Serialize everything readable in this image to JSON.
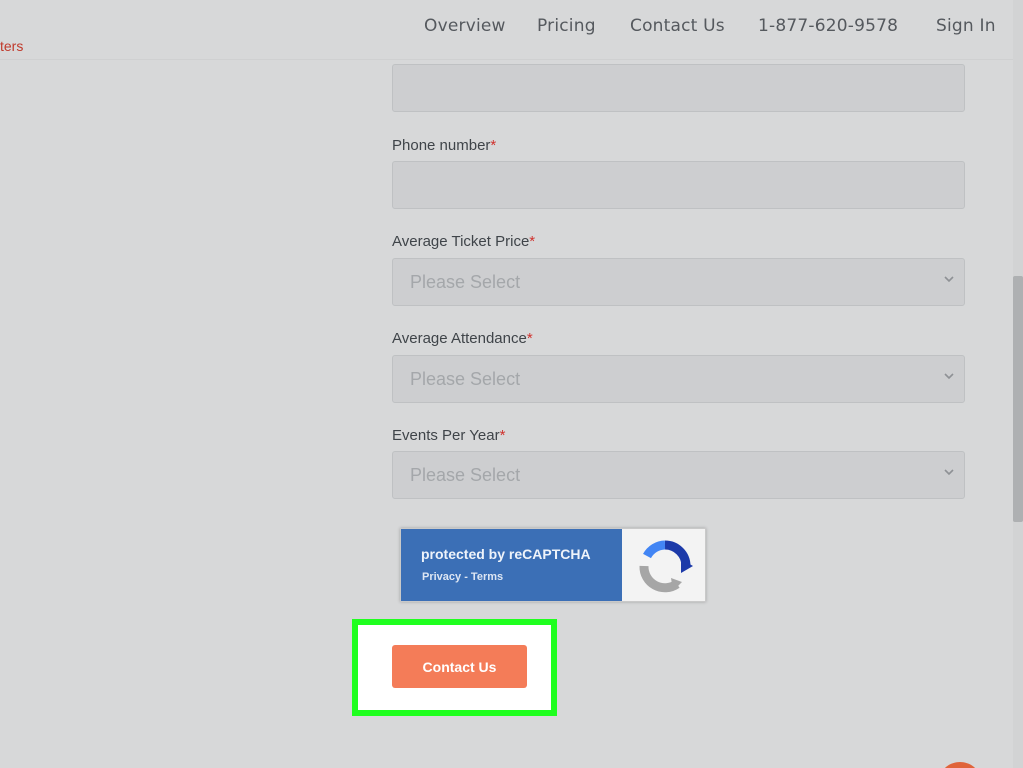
{
  "header": {
    "brand_fragment": "ters",
    "nav": [
      {
        "label": "Overview"
      },
      {
        "label": "Pricing"
      },
      {
        "label": "Contact Us"
      },
      {
        "label": "1-877-620-9578"
      },
      {
        "label": "Sign In"
      }
    ]
  },
  "form": {
    "required_mark": "*",
    "phone": {
      "label": "Phone number",
      "value": ""
    },
    "avg_ticket_price": {
      "label": "Average Ticket Price",
      "placeholder": "Please Select"
    },
    "avg_attendance": {
      "label": "Average Attendance",
      "placeholder": "Please Select"
    },
    "events_per_year": {
      "label": "Events Per Year",
      "placeholder": "Please Select"
    }
  },
  "recaptcha": {
    "title": "protected by reCAPTCHA",
    "links": "Privacy - Terms"
  },
  "submit": {
    "label": "Contact Us"
  },
  "colors": {
    "accent": "#f47c58",
    "highlight": "#1fff1f",
    "recaptcha_blue": "#3b6fb6",
    "required": "#d0312d"
  }
}
